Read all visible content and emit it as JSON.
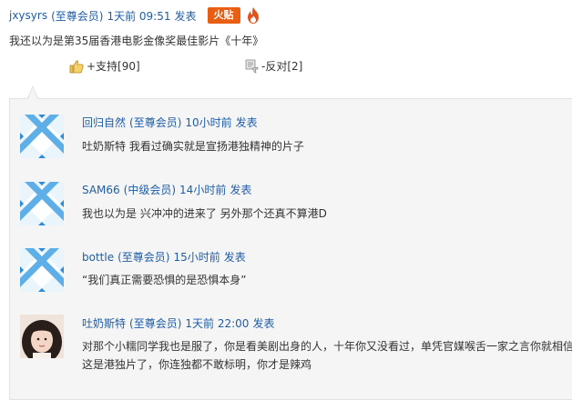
{
  "post": {
    "username": "jxysyrs",
    "level": "(至尊会员)",
    "time": "1天前 09:51",
    "action": "发表",
    "badge": "火贴",
    "text": "我还以为是第35届香港电影金像奖最佳影片《十年》",
    "support": "+支持[90]",
    "oppose": "-反对[2]"
  },
  "replies": [
    {
      "username": "回归自然",
      "level": "(至尊会员)",
      "time": "10小时前",
      "action": "发表",
      "text": "吐奶斯特 我看过确实就是宣扬港独精神的片子",
      "avatar": "default-x-icon"
    },
    {
      "username": "SAM66",
      "level": "(中级会员)",
      "time": "14小时前",
      "action": "发表",
      "text": "我也以为是 兴冲冲的进来了 另外那个还真不算港D",
      "avatar": "default-x-icon"
    },
    {
      "username": "bottle",
      "level": "(至尊会员)",
      "time": "15小时前",
      "action": "发表",
      "text": "“我们真正需要恐惧的是恐惧本身”",
      "avatar": "default-x-icon"
    },
    {
      "username": "吐奶斯特",
      "level": "(至尊会员)",
      "time": "1天前 22:00",
      "action": "发表",
      "text": "对那个小糯同学我也是服了，你是看美剧出身的人，十年你又没看过，单凭官媒喉舌一家之言你就相信这是港独片了，你连独都不敢标明，你才是辣鸡",
      "avatar": "photo-avatar"
    }
  ],
  "colors": {
    "link": "#1f5da8",
    "badge": "#e85f14",
    "avatar_blue": "#2d8ad6"
  }
}
